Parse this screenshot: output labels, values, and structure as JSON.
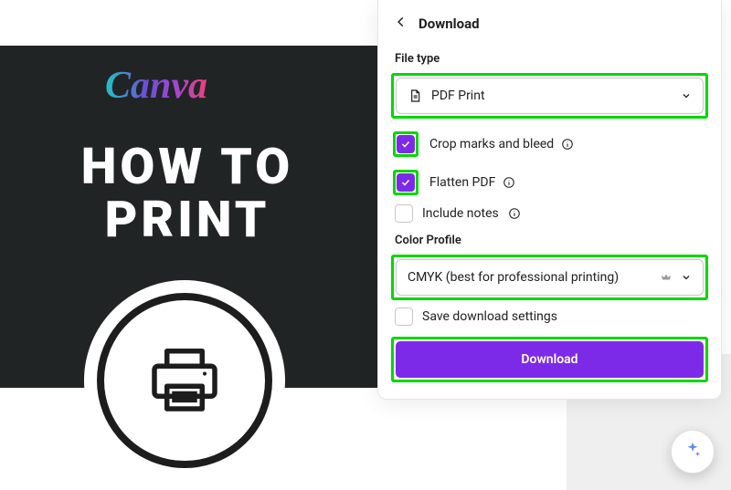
{
  "canvas": {
    "logo_text": "Canva",
    "headline_line1": "HOW TO",
    "headline_line2": "PRINT"
  },
  "panel": {
    "header_title": "Download",
    "file_type_label": "File type",
    "file_type_value": "PDF Print",
    "checkbox_crop": "Crop marks and bleed",
    "checkbox_flatten": "Flatten PDF",
    "checkbox_notes": "Include notes",
    "color_profile_label": "Color Profile",
    "color_profile_value": "CMYK (best for professional printing)",
    "save_settings": "Save download settings",
    "download_button": "Download"
  }
}
